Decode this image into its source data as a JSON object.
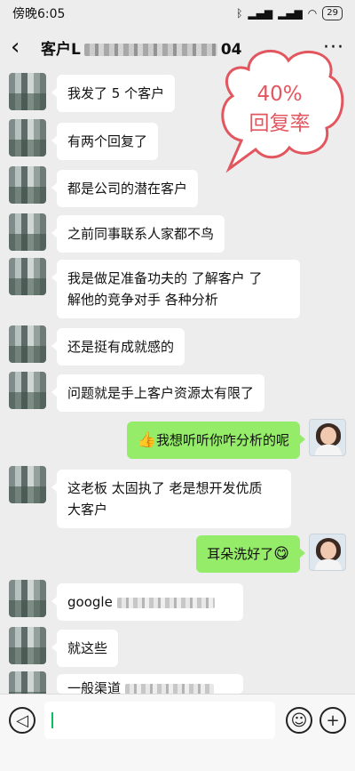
{
  "status_bar": {
    "time": "傍晚6:05",
    "battery": "29"
  },
  "header": {
    "title_prefix": "客户L",
    "title_suffix": "04"
  },
  "callout": {
    "line1": "40%",
    "line2": "回复率"
  },
  "messages": [
    {
      "side": "left",
      "text": "我发了 5 个客户"
    },
    {
      "side": "left",
      "text": "有两个回复了"
    },
    {
      "side": "left",
      "text": "都是公司的潜在客户"
    },
    {
      "side": "left",
      "text": "之前同事联系人家都不鸟"
    },
    {
      "side": "left",
      "line1": "我是做足准备功夫的  了解客户  了",
      "line2": "解他的竞争对手 各种分析"
    },
    {
      "side": "left",
      "text": "还是挺有成就感的"
    },
    {
      "side": "left",
      "text": "问题就是手上客户资源太有限了"
    },
    {
      "side": "right",
      "emoji": "👍",
      "text": "我想听听你咋分析的呢"
    },
    {
      "side": "left",
      "line1": "这老板 太固执了  老是想开发优质",
      "line2": "大客户"
    },
    {
      "side": "right",
      "text": "耳朵洗好了",
      "emoji": "😋"
    },
    {
      "side": "left",
      "text": "google"
    },
    {
      "side": "left",
      "text": "就这些"
    },
    {
      "side": "left",
      "text": "一般渠道"
    }
  ],
  "input_bar": {
    "voice_icon": "voice-icon",
    "emoji_icon": "emoji-icon",
    "add_icon": "plus-icon"
  }
}
